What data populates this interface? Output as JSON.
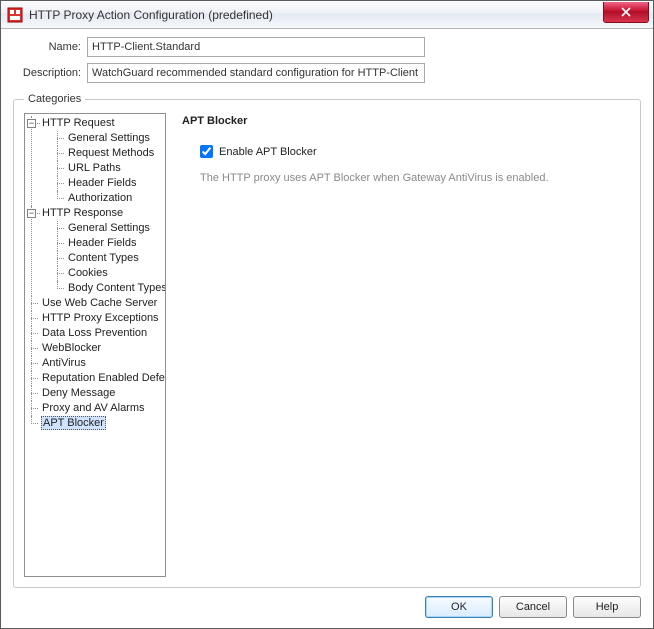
{
  "window": {
    "title": "HTTP Proxy Action Configuration (predefined)"
  },
  "form": {
    "name_label": "Name:",
    "name_value": "HTTP-Client.Standard",
    "desc_label": "Description:",
    "desc_value": "WatchGuard recommended standard configuration for HTTP-Client with logging en"
  },
  "categories": {
    "legend": "Categories",
    "tree": {
      "http_request": "HTTP Request",
      "req_general": "General Settings",
      "req_methods": "Request Methods",
      "req_urlpaths": "URL Paths",
      "req_headers": "Header Fields",
      "req_auth": "Authorization",
      "http_response": "HTTP Response",
      "res_general": "General Settings",
      "res_headers": "Header Fields",
      "res_content": "Content Types",
      "res_cookies": "Cookies",
      "res_body": "Body Content Types",
      "webcache": "Use Web Cache Server",
      "proxy_exc": "HTTP Proxy Exceptions",
      "dlp": "Data Loss Prevention",
      "webblocker": "WebBlocker",
      "antivirus": "AntiVirus",
      "reputation": "Reputation Enabled Defense",
      "deny_msg": "Deny Message",
      "proxy_alarms": "Proxy and AV Alarms",
      "apt_blocker": "APT Blocker"
    }
  },
  "panel": {
    "heading": "APT Blocker",
    "checkbox_label": "Enable APT Blocker",
    "checkbox_checked": true,
    "info": "The HTTP proxy uses APT Blocker when Gateway AntiVirus is enabled."
  },
  "buttons": {
    "ok": "OK",
    "cancel": "Cancel",
    "help": "Help"
  }
}
